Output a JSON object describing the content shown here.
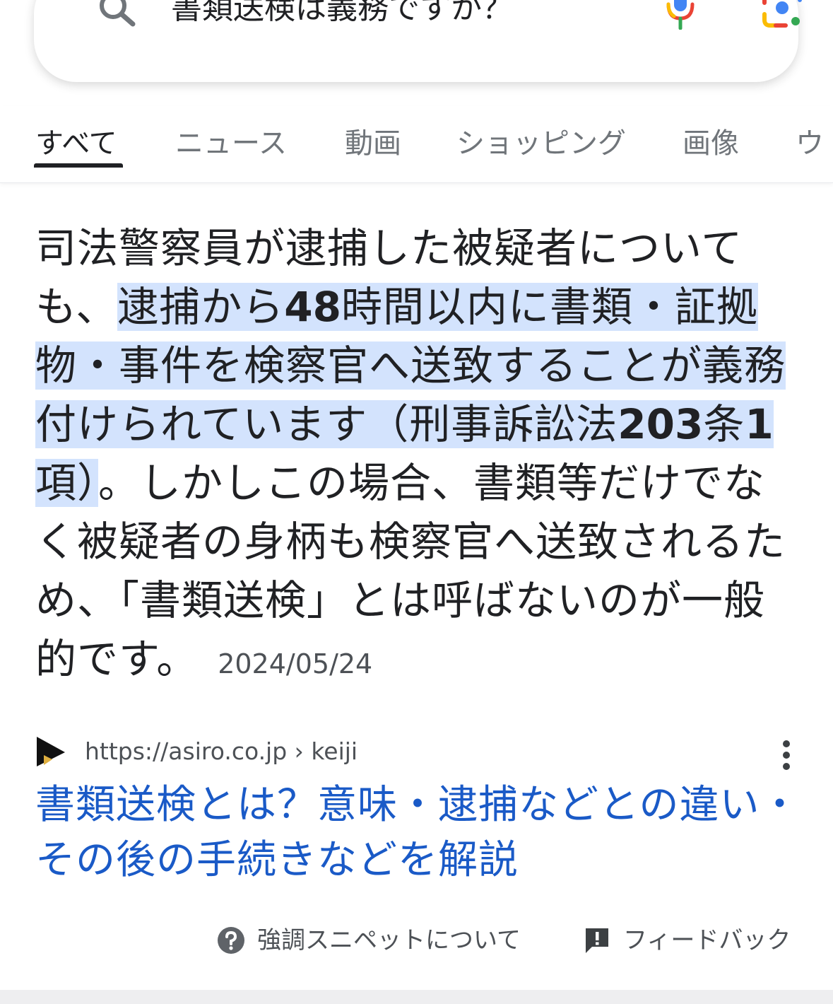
{
  "search": {
    "query": "書類送検は義務ですか？",
    "icons": [
      "search-icon",
      "mic-icon",
      "lens-icon"
    ]
  },
  "tabs": [
    {
      "label": "すべて",
      "active": true
    },
    {
      "label": "ニュース",
      "active": false
    },
    {
      "label": "動画",
      "active": false
    },
    {
      "label": "ショッピング",
      "active": false
    },
    {
      "label": "画像",
      "active": false
    },
    {
      "label": "ウ",
      "active": false
    }
  ],
  "snippet": {
    "part1": "司法警察員が逮捕した被疑者についても、",
    "hl_a": "逮捕から",
    "hl_num1": "48",
    "hl_b": "時間以内に書類・証拠物・事件を検察官へ送致することが義務付けられています（刑事訴訟法",
    "hl_num2": "203",
    "hl_c": "条",
    "hl_num3": "1",
    "hl_d": "項）",
    "part2": "。しかしこの場合、書類等だけでなく被疑者の身柄も検察官へ送致されるため、「書類送検」とは呼ばないのが一般的です。",
    "date": "2024/05/24"
  },
  "source": {
    "url": "https://asiro.co.jp › keiji",
    "title": "書類送検とは？意味・逮捕などとの違い・その後の手続きなどを解説"
  },
  "footer": {
    "help_label": "強調スニペットについて",
    "feedback_label": "フィードバック"
  },
  "colors": {
    "highlight": "#d3e3fd",
    "link": "#1a5ac7",
    "text": "#202124",
    "secondary": "#4d5156"
  }
}
